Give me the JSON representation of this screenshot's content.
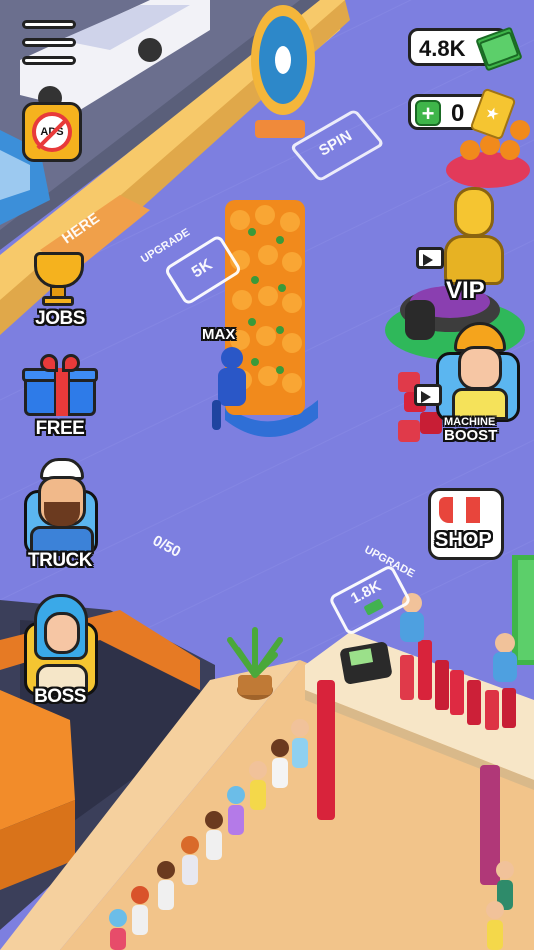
{
  "hud": {
    "cash_value": "4.8K",
    "tickets_value": "0",
    "ads_label": "ADS"
  },
  "floor": {
    "spin_label": "SPIN",
    "here_label": "HERE",
    "upgrade_label_1": "UPGRADE",
    "upgrade_price_1": "5K",
    "upgrade_label_2": "UPGRADE",
    "upgrade_price_2": "1.8K",
    "capacity_counter": "0/50",
    "max_label": "MAX"
  },
  "side_buttons": {
    "jobs_label": "JOBS",
    "free_label": "FREE",
    "truck_label": "TRUCK",
    "boss_label": "BOSS"
  },
  "right_buttons": {
    "vip_label": "VIP",
    "machine_label": "MACHINE",
    "boost_label": "BOOST",
    "shop_label": "SHOP"
  },
  "colors": {
    "floor": "#7d7fe0",
    "wall": "#f7c96a",
    "counter_floor": "#f2c48a",
    "cash_green": "#3fb54a",
    "shop_red": "#e8453c"
  }
}
